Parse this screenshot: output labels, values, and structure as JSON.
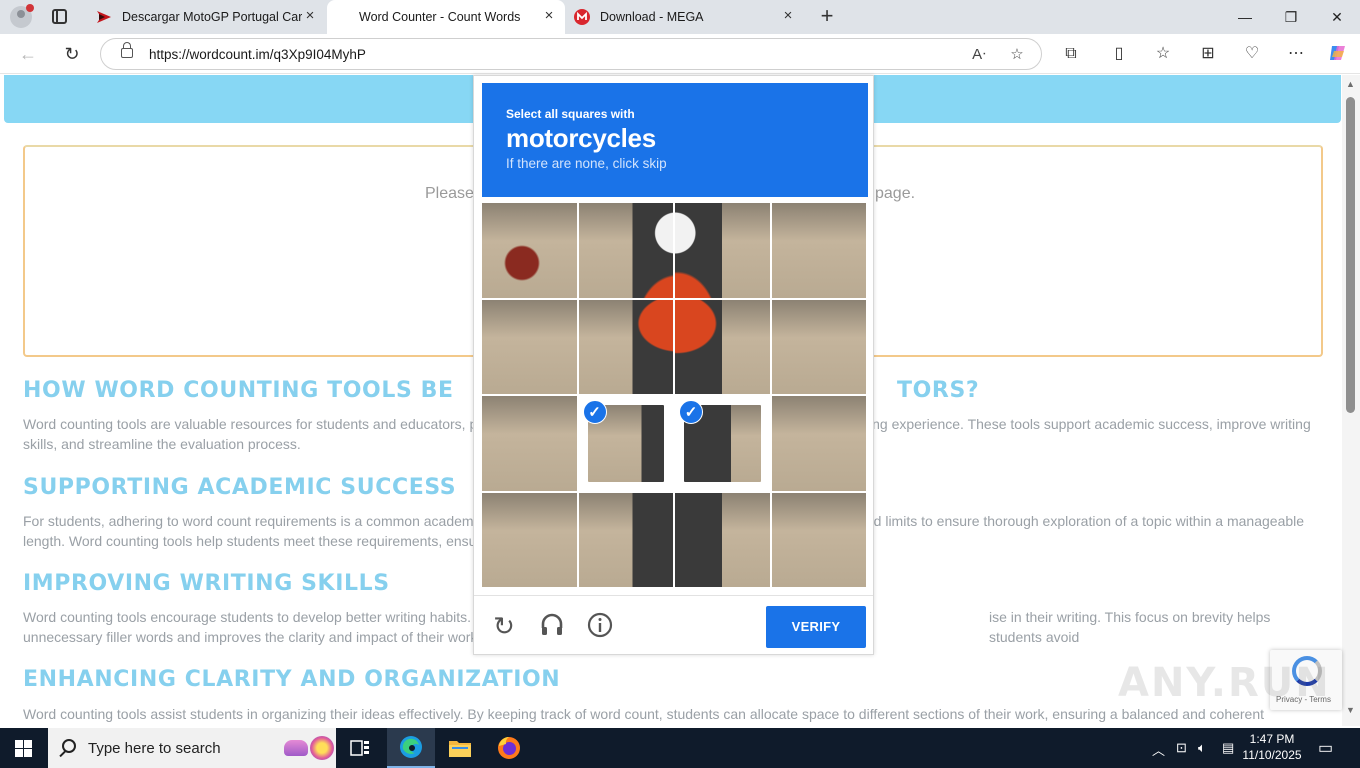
{
  "browser": {
    "tabs": [
      {
        "title": "Descargar MotoGP Portugal Carre",
        "active": false
      },
      {
        "title": "Word Counter - Count Words",
        "active": true
      },
      {
        "title": "Download - MEGA",
        "active": false
      }
    ],
    "new_tab": "+",
    "url": "https://wordcount.im/q3Xp9I04MyhP",
    "window_controls": {
      "minimize": "—",
      "maximize": "❐",
      "close": "✕"
    }
  },
  "page": {
    "textbox_placeholder_start": "Please",
    "textbox_placeholder_end": "page.",
    "sections": [
      {
        "heading": "HOW WORD COUNTING TOOLS BE",
        "heading_tail": "TORS?",
        "body_start": "Word counting tools are valuable resources for students and educators, p",
        "body_end": "ing experience. These tools support academic success, improve writing",
        "body_line2": "skills, and streamline the evaluation process."
      },
      {
        "heading": "SUPPORTING ACADEMIC SUCCESS",
        "heading_tail": "",
        "body_start": "For students, adhering to word count requirements is a common academ",
        "body_end": "rd limits to ensure thorough exploration of a topic within a manageable",
        "body_line2": "length. Word counting tools help students meet these requirements, ensu"
      },
      {
        "heading": "IMPROVING WRITING SKILLS",
        "heading_tail": "",
        "body_start": "Word counting tools encourage students to develop better writing habits.",
        "body_end": "ise in their writing. This focus on brevity helps students avoid",
        "body_line2": "unnecessary filler words and improves the clarity and impact of their work"
      },
      {
        "heading": "ENHANCING CLARITY AND ORGANIZATION",
        "heading_tail": "",
        "body_start": "Word counting tools assist students in organizing their ideas effectively. By keeping track of word count, students can allocate space to different sections of their work, ensuring a balanced and coherent",
        "body_end": "",
        "body_line2": ""
      }
    ]
  },
  "captcha": {
    "instruction": "Select all squares with",
    "target": "motorcycles",
    "hint": "If there are none, click skip",
    "selected_tiles": [
      9,
      10
    ],
    "verify_label": "VERIFY",
    "icons": [
      "reload-icon",
      "audio-icon",
      "info-icon"
    ]
  },
  "recaptcha_badge": {
    "text": "Privacy - Terms"
  },
  "watermark": "ANY.RUN",
  "taskbar": {
    "search_placeholder": "Type here to search",
    "time": "1:47 PM",
    "date": "11/10/2025"
  },
  "colors": {
    "banner": "#87d7f4",
    "heading": "#86d0ee",
    "captcha_blue": "#1a73e8"
  }
}
